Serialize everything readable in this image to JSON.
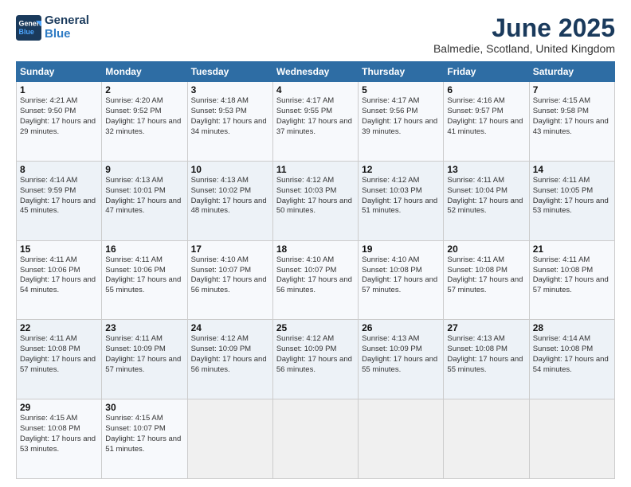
{
  "logo": {
    "line1": "General",
    "line2": "Blue"
  },
  "title": "June 2025",
  "location": "Balmedie, Scotland, United Kingdom",
  "days_header": [
    "Sunday",
    "Monday",
    "Tuesday",
    "Wednesday",
    "Thursday",
    "Friday",
    "Saturday"
  ],
  "weeks": [
    [
      {
        "day": "1",
        "sunrise": "4:21 AM",
        "sunset": "9:50 PM",
        "daylight": "17 hours and 29 minutes."
      },
      {
        "day": "2",
        "sunrise": "4:20 AM",
        "sunset": "9:52 PM",
        "daylight": "17 hours and 32 minutes."
      },
      {
        "day": "3",
        "sunrise": "4:18 AM",
        "sunset": "9:53 PM",
        "daylight": "17 hours and 34 minutes."
      },
      {
        "day": "4",
        "sunrise": "4:17 AM",
        "sunset": "9:55 PM",
        "daylight": "17 hours and 37 minutes."
      },
      {
        "day": "5",
        "sunrise": "4:17 AM",
        "sunset": "9:56 PM",
        "daylight": "17 hours and 39 minutes."
      },
      {
        "day": "6",
        "sunrise": "4:16 AM",
        "sunset": "9:57 PM",
        "daylight": "17 hours and 41 minutes."
      },
      {
        "day": "7",
        "sunrise": "4:15 AM",
        "sunset": "9:58 PM",
        "daylight": "17 hours and 43 minutes."
      }
    ],
    [
      {
        "day": "8",
        "sunrise": "4:14 AM",
        "sunset": "9:59 PM",
        "daylight": "17 hours and 45 minutes."
      },
      {
        "day": "9",
        "sunrise": "4:13 AM",
        "sunset": "10:01 PM",
        "daylight": "17 hours and 47 minutes."
      },
      {
        "day": "10",
        "sunrise": "4:13 AM",
        "sunset": "10:02 PM",
        "daylight": "17 hours and 48 minutes."
      },
      {
        "day": "11",
        "sunrise": "4:12 AM",
        "sunset": "10:03 PM",
        "daylight": "17 hours and 50 minutes."
      },
      {
        "day": "12",
        "sunrise": "4:12 AM",
        "sunset": "10:03 PM",
        "daylight": "17 hours and 51 minutes."
      },
      {
        "day": "13",
        "sunrise": "4:11 AM",
        "sunset": "10:04 PM",
        "daylight": "17 hours and 52 minutes."
      },
      {
        "day": "14",
        "sunrise": "4:11 AM",
        "sunset": "10:05 PM",
        "daylight": "17 hours and 53 minutes."
      }
    ],
    [
      {
        "day": "15",
        "sunrise": "4:11 AM",
        "sunset": "10:06 PM",
        "daylight": "17 hours and 54 minutes."
      },
      {
        "day": "16",
        "sunrise": "4:11 AM",
        "sunset": "10:06 PM",
        "daylight": "17 hours and 55 minutes."
      },
      {
        "day": "17",
        "sunrise": "4:10 AM",
        "sunset": "10:07 PM",
        "daylight": "17 hours and 56 minutes."
      },
      {
        "day": "18",
        "sunrise": "4:10 AM",
        "sunset": "10:07 PM",
        "daylight": "17 hours and 56 minutes."
      },
      {
        "day": "19",
        "sunrise": "4:10 AM",
        "sunset": "10:08 PM",
        "daylight": "17 hours and 57 minutes."
      },
      {
        "day": "20",
        "sunrise": "4:11 AM",
        "sunset": "10:08 PM",
        "daylight": "17 hours and 57 minutes."
      },
      {
        "day": "21",
        "sunrise": "4:11 AM",
        "sunset": "10:08 PM",
        "daylight": "17 hours and 57 minutes."
      }
    ],
    [
      {
        "day": "22",
        "sunrise": "4:11 AM",
        "sunset": "10:08 PM",
        "daylight": "17 hours and 57 minutes."
      },
      {
        "day": "23",
        "sunrise": "4:11 AM",
        "sunset": "10:09 PM",
        "daylight": "17 hours and 57 minutes."
      },
      {
        "day": "24",
        "sunrise": "4:12 AM",
        "sunset": "10:09 PM",
        "daylight": "17 hours and 56 minutes."
      },
      {
        "day": "25",
        "sunrise": "4:12 AM",
        "sunset": "10:09 PM",
        "daylight": "17 hours and 56 minutes."
      },
      {
        "day": "26",
        "sunrise": "4:13 AM",
        "sunset": "10:09 PM",
        "daylight": "17 hours and 55 minutes."
      },
      {
        "day": "27",
        "sunrise": "4:13 AM",
        "sunset": "10:08 PM",
        "daylight": "17 hours and 55 minutes."
      },
      {
        "day": "28",
        "sunrise": "4:14 AM",
        "sunset": "10:08 PM",
        "daylight": "17 hours and 54 minutes."
      }
    ],
    [
      {
        "day": "29",
        "sunrise": "4:15 AM",
        "sunset": "10:08 PM",
        "daylight": "17 hours and 53 minutes."
      },
      {
        "day": "30",
        "sunrise": "4:15 AM",
        "sunset": "10:07 PM",
        "daylight": "17 hours and 51 minutes."
      },
      null,
      null,
      null,
      null,
      null
    ]
  ]
}
